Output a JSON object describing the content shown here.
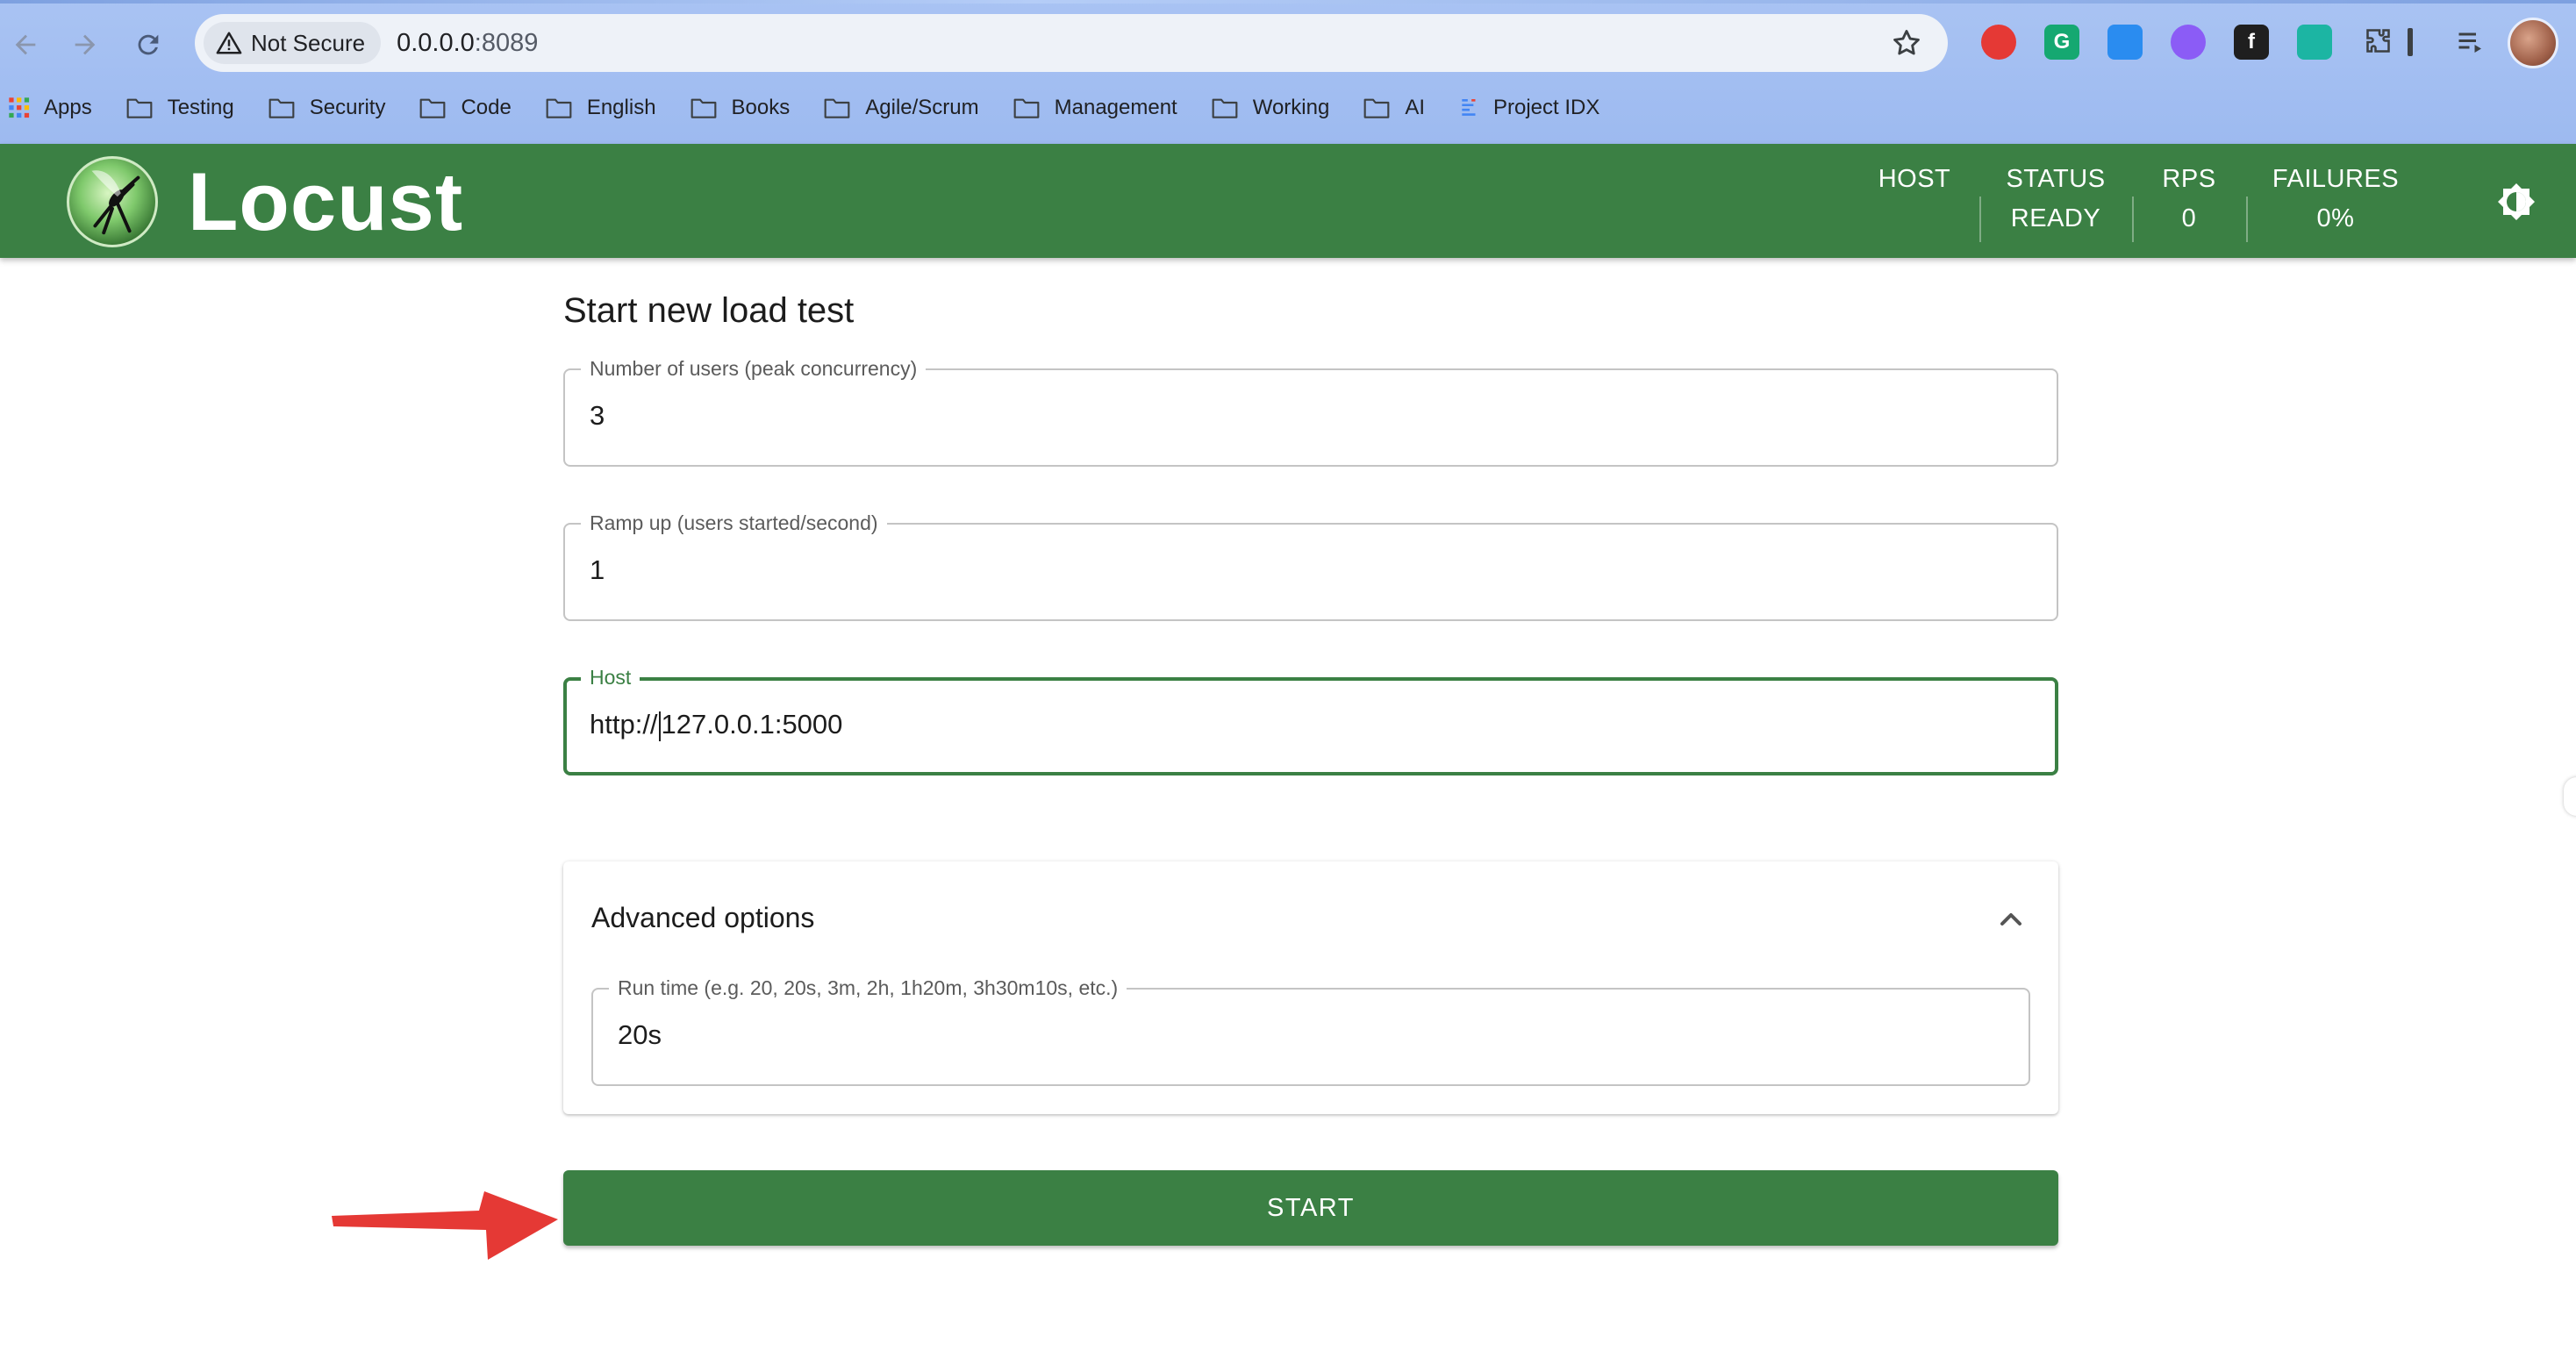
{
  "browser": {
    "security_label": "Not Secure",
    "url_host": "0.0.0.0",
    "url_port": ":8089",
    "bookmarks": [
      {
        "label": "Apps",
        "icon": "apps-grid-icon"
      },
      {
        "label": "Testing",
        "icon": "folder-icon"
      },
      {
        "label": "Security",
        "icon": "folder-icon"
      },
      {
        "label": "Code",
        "icon": "folder-icon"
      },
      {
        "label": "English",
        "icon": "folder-icon"
      },
      {
        "label": "Books",
        "icon": "folder-icon"
      },
      {
        "label": "Agile/Scrum",
        "icon": "folder-icon"
      },
      {
        "label": "Management",
        "icon": "folder-icon"
      },
      {
        "label": "Working",
        "icon": "folder-icon"
      },
      {
        "label": "AI",
        "icon": "folder-icon"
      },
      {
        "label": "Project IDX",
        "icon": "project-idx-icon"
      }
    ],
    "extensions": [
      {
        "name": "adblock-icon",
        "color": "#e53935",
        "glyph": ""
      },
      {
        "name": "grammarly-icon",
        "color": "#15a871",
        "glyph": "G"
      },
      {
        "name": "raindrop-icon",
        "color": "#2a8cf0",
        "glyph": ""
      },
      {
        "name": "brain-icon",
        "color": "#8b5cf6",
        "glyph": ""
      },
      {
        "name": "formula-icon",
        "color": "#1f1f1f",
        "glyph": "f"
      },
      {
        "name": "arc-icon",
        "color": "#1cb5a3",
        "glyph": ""
      }
    ]
  },
  "app": {
    "brand": "Locust",
    "stats": {
      "host_label": "HOST",
      "host_value": "",
      "status_label": "STATUS",
      "status_value": "READY",
      "rps_label": "RPS",
      "rps_value": "0",
      "failures_label": "FAILURES",
      "failures_value": "0%"
    },
    "colors": {
      "primary": "#3b8044",
      "arrow": "#e53935"
    }
  },
  "form": {
    "title": "Start new load test",
    "users": {
      "label": "Number of users (peak concurrency)",
      "value": "3"
    },
    "ramp_up": {
      "label": "Ramp up (users started/second)",
      "value": "1"
    },
    "host": {
      "label": "Host",
      "value_before_caret": "http://",
      "value_after_caret": "127.0.0.1:5000"
    },
    "advanced": {
      "title": "Advanced options",
      "expanded": true,
      "run_time": {
        "label": "Run time (e.g. 20, 20s, 3m, 2h, 1h20m, 3h30m10s, etc.)",
        "value": "20s"
      }
    },
    "start_label": "START"
  }
}
